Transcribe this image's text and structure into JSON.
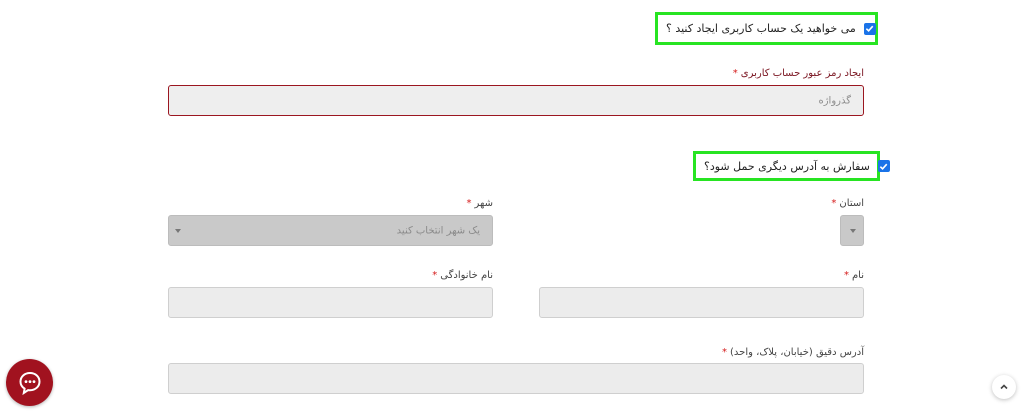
{
  "create_account": {
    "question": "می خواهید یک حساب کاربری ایجاد کنید ؟",
    "checked": true
  },
  "password": {
    "label": "ایجاد رمز عبور حساب کاربری",
    "required_mark": "*",
    "placeholder": "گذرواژه"
  },
  "ship_different": {
    "question": "سفارش به آدرس دیگری حمل شود؟",
    "checked": true
  },
  "province": {
    "label": "استان",
    "required_mark": "*",
    "value": ""
  },
  "city": {
    "label": "شهر",
    "required_mark": "*",
    "placeholder": "یک شهر انتخاب کنید"
  },
  "first_name": {
    "label": "نام",
    "required_mark": "*",
    "value": ""
  },
  "last_name": {
    "label": "نام خانوادگی",
    "required_mark": "*",
    "value": ""
  },
  "address": {
    "label": "آدرس دقیق (خیابان، پلاک، واحد)",
    "required_mark": "*",
    "value": ""
  },
  "floating": {
    "chat_icon": "chat-bubble-icon",
    "scroll_top_icon": "chevron-up-icon"
  },
  "colors": {
    "highlight": "#27e422",
    "checkbox": "#1a73e8",
    "required": "#d51a1a",
    "error_border": "#9b1620",
    "chat_button": "#a1121f"
  }
}
